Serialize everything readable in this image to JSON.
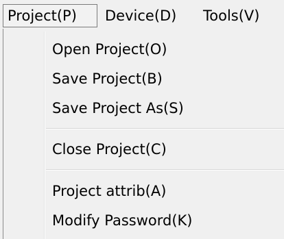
{
  "menubar": {
    "items": [
      {
        "label": "Project(P)"
      },
      {
        "label": "Device(D)"
      },
      {
        "label": "Tools(V)"
      }
    ]
  },
  "project_menu": {
    "items": [
      {
        "label": "Open Project(O)"
      },
      {
        "label": "Save Project(B)"
      },
      {
        "label": "Save Project As(S)"
      },
      {
        "label": "Close Project(C)"
      },
      {
        "label": "Project attrib(A)"
      },
      {
        "label": "Modify Password(K)"
      }
    ]
  }
}
